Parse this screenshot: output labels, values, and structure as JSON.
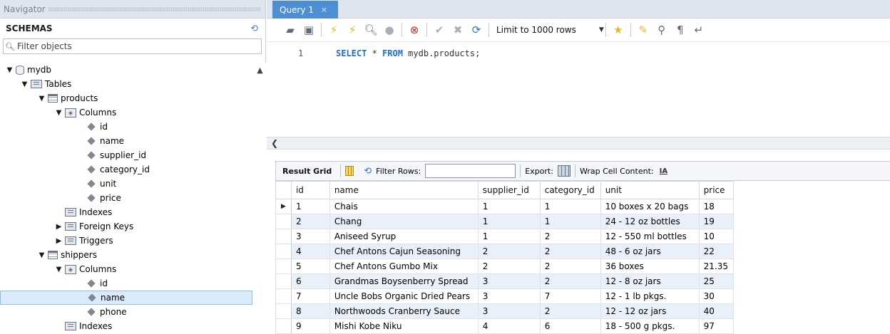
{
  "navigator": {
    "title": "Navigator",
    "schemas_label": "SCHEMAS",
    "filter_placeholder": "Filter objects",
    "tree": [
      {
        "label": "mydb",
        "depth": 0,
        "toggle": "▼",
        "icon": "database-icon",
        "name": "tree-item-mydb"
      },
      {
        "label": "Tables",
        "depth": 1,
        "toggle": "▼",
        "icon": "folder-icon",
        "name": "tree-item-tables"
      },
      {
        "label": "products",
        "depth": 2,
        "toggle": "▼",
        "icon": "table-icon",
        "name": "tree-item-products"
      },
      {
        "label": "Columns",
        "depth": 3,
        "toggle": "▼",
        "icon": "columns-icon",
        "name": "tree-item-products-columns"
      },
      {
        "label": "id",
        "depth": 4,
        "toggle": "",
        "icon": "column-bullet-icon",
        "name": "tree-item-column-id"
      },
      {
        "label": "name",
        "depth": 4,
        "toggle": "",
        "icon": "column-bullet-icon",
        "name": "tree-item-column-name"
      },
      {
        "label": "supplier_id",
        "depth": 4,
        "toggle": "",
        "icon": "column-bullet-icon",
        "name": "tree-item-column-supplier-id"
      },
      {
        "label": "category_id",
        "depth": 4,
        "toggle": "",
        "icon": "column-bullet-icon",
        "name": "tree-item-column-category-id"
      },
      {
        "label": "unit",
        "depth": 4,
        "toggle": "",
        "icon": "column-bullet-icon",
        "name": "tree-item-column-unit"
      },
      {
        "label": "price",
        "depth": 4,
        "toggle": "",
        "icon": "column-bullet-icon",
        "name": "tree-item-column-price"
      },
      {
        "label": "Indexes",
        "depth": 3,
        "toggle": "",
        "icon": "folder-icon",
        "name": "tree-item-products-indexes"
      },
      {
        "label": "Foreign Keys",
        "depth": 3,
        "toggle": "▶",
        "icon": "folder-icon",
        "name": "tree-item-products-foreign-keys"
      },
      {
        "label": "Triggers",
        "depth": 3,
        "toggle": "▶",
        "icon": "folder-icon",
        "name": "tree-item-products-triggers"
      },
      {
        "label": "shippers",
        "depth": 2,
        "toggle": "▼",
        "icon": "table-icon",
        "name": "tree-item-shippers"
      },
      {
        "label": "Columns",
        "depth": 3,
        "toggle": "▼",
        "icon": "columns-icon",
        "name": "tree-item-shippers-columns"
      },
      {
        "label": "id",
        "depth": 4,
        "toggle": "",
        "icon": "column-bullet-icon",
        "name": "tree-item-shippers-column-id"
      },
      {
        "label": "name",
        "depth": 4,
        "toggle": "",
        "icon": "column-bullet-icon",
        "name": "tree-item-shippers-column-name",
        "selected": true
      },
      {
        "label": "phone",
        "depth": 4,
        "toggle": "",
        "icon": "column-bullet-icon",
        "name": "tree-item-shippers-column-phone"
      },
      {
        "label": "Indexes",
        "depth": 3,
        "toggle": "",
        "icon": "folder-icon",
        "name": "tree-item-shippers-indexes"
      }
    ]
  },
  "editor": {
    "tab_label": "Query 1",
    "tab_close": "×",
    "limit_label": "Limit to 1000 rows",
    "line_number": "1",
    "sql": {
      "kw1": "SELECT",
      "star": " * ",
      "kw2": "FROM",
      "rest": " mydb.products;"
    },
    "toolbar_icons": [
      "open-folder-icon",
      "save-icon",
      "execute-icon",
      "execute-current-icon",
      "explain-icon",
      "stop-icon",
      "toggle-error-icon",
      "commit-icon",
      "rollback-icon",
      "autocommit-icon",
      "limit-rows-select",
      "add-snippet-icon",
      "beautify-icon",
      "find-icon",
      "invisible-chars-icon",
      "wrap-lines-icon"
    ]
  },
  "results": {
    "result_grid_label": "Result Grid",
    "filter_rows_label": "Filter Rows:",
    "export_label": "Export:",
    "wrap_label": "Wrap Cell Content:",
    "columns": [
      "id",
      "name",
      "supplier_id",
      "category_id",
      "unit",
      "price"
    ],
    "rows": [
      [
        "1",
        "Chais",
        "1",
        "1",
        "10 boxes x 20 bags",
        "18"
      ],
      [
        "2",
        "Chang",
        "1",
        "1",
        "24 - 12 oz bottles",
        "19"
      ],
      [
        "3",
        "Aniseed Syrup",
        "1",
        "2",
        "12 - 550 ml bottles",
        "10"
      ],
      [
        "4",
        "Chef Antons Cajun Seasoning",
        "2",
        "2",
        "48 - 6 oz jars",
        "22"
      ],
      [
        "5",
        "Chef Antons Gumbo Mix",
        "2",
        "2",
        "36 boxes",
        "21.35"
      ],
      [
        "6",
        "Grandmas Boysenberry Spread",
        "3",
        "2",
        "12 - 8 oz jars",
        "25"
      ],
      [
        "7",
        "Uncle Bobs Organic Dried Pears",
        "3",
        "7",
        "12 - 1 lb pkgs.",
        "30"
      ],
      [
        "8",
        "Northwoods Cranberry Sauce",
        "3",
        "2",
        "12 - 12 oz jars",
        "40"
      ],
      [
        "9",
        "Mishi Kobe Niku",
        "4",
        "6",
        "18 - 500 g pkgs.",
        "97"
      ]
    ],
    "current_row_marker": "▶"
  },
  "colors": {
    "tab_active": "#4e8fd3",
    "keyword": "#1d6fd8",
    "row_alt": "#e9f0f9",
    "selection": "#dcebfb"
  }
}
